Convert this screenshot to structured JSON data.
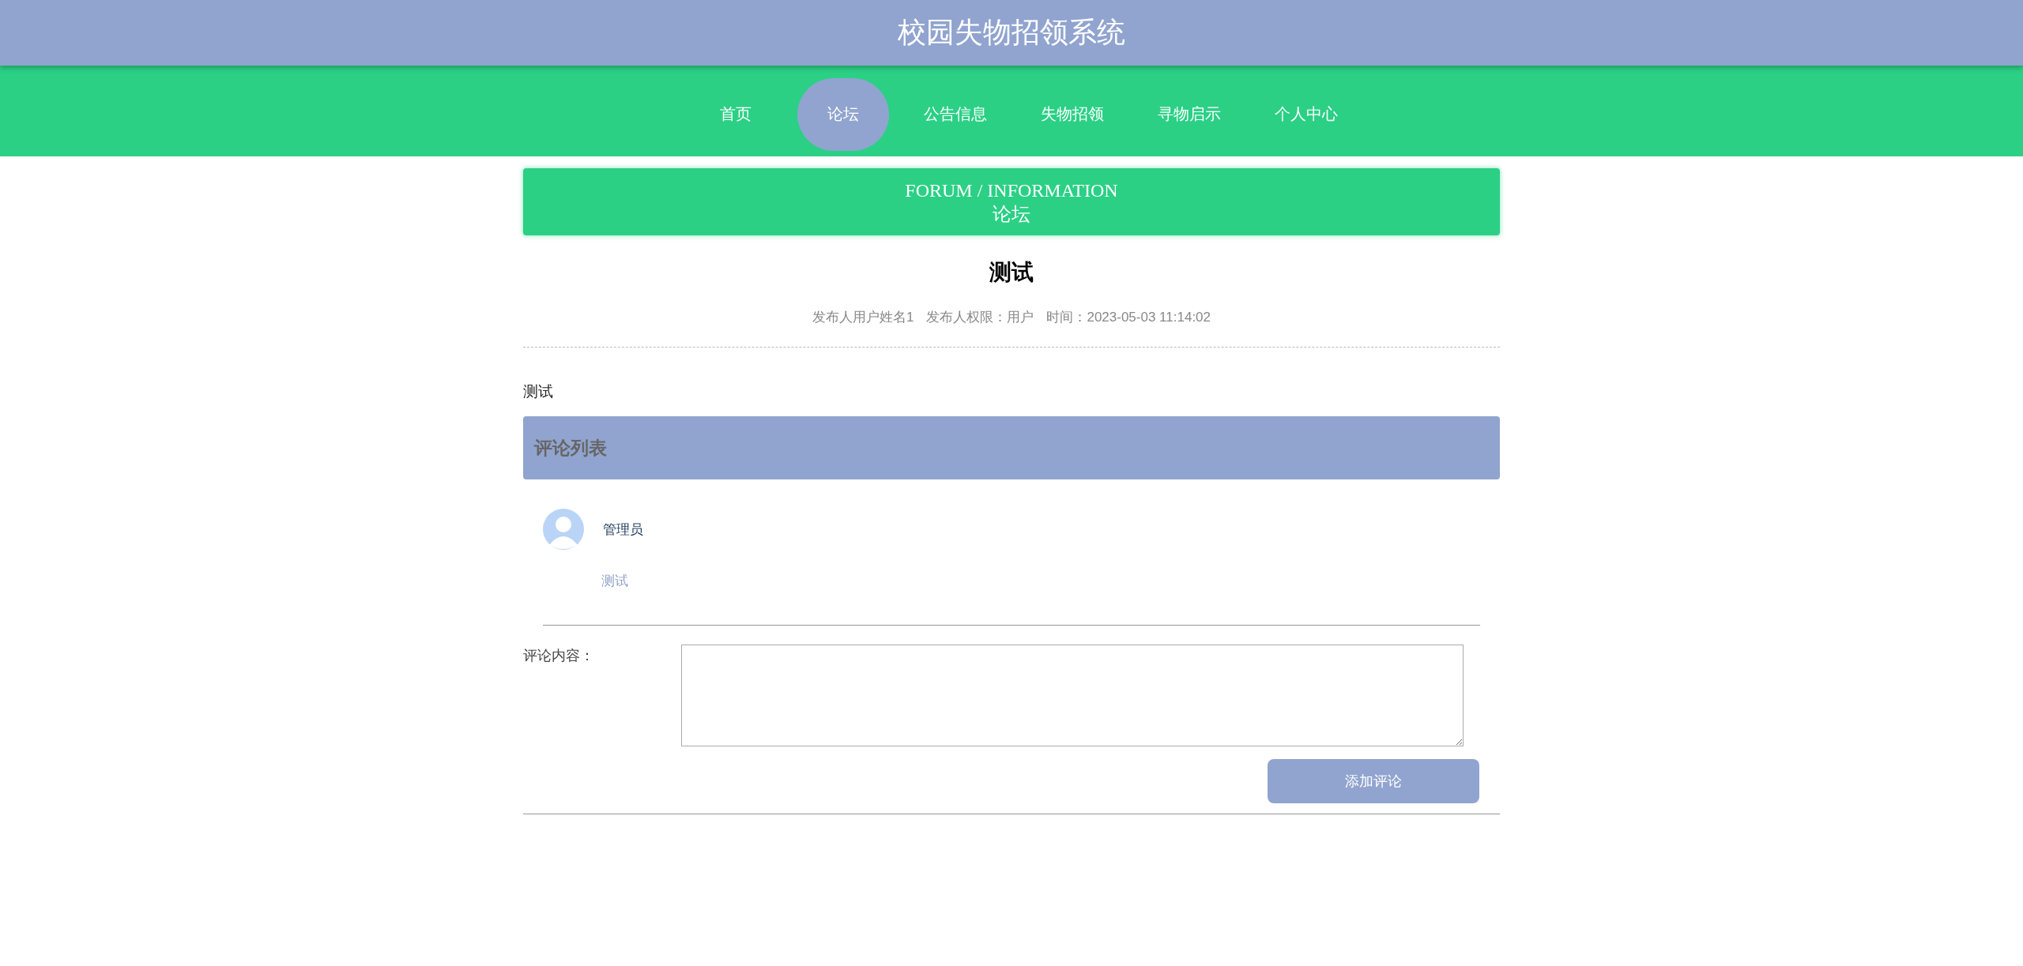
{
  "header": {
    "title": "校园失物招领系统"
  },
  "nav": [
    {
      "label": "首页",
      "selected": false
    },
    {
      "label": "论坛",
      "selected": true
    },
    {
      "label": "公告信息",
      "selected": false
    },
    {
      "label": "失物招领",
      "selected": false
    },
    {
      "label": "寻物启示",
      "selected": false
    },
    {
      "label": "个人中心",
      "selected": false
    }
  ],
  "banner": {
    "subtitle": "FORUM / INFORMATION",
    "title": "论坛"
  },
  "post": {
    "title": "测试",
    "author": "发布人用户姓名1",
    "role": "发布人权限：用户",
    "time": "时间：2023-05-03 11:14:02",
    "content": "测试"
  },
  "comments_header": "评论列表",
  "comments": [
    {
      "user": "管理员",
      "text": "测试"
    }
  ],
  "comment_form": {
    "label": "评论内容：",
    "button": "添加评论"
  }
}
